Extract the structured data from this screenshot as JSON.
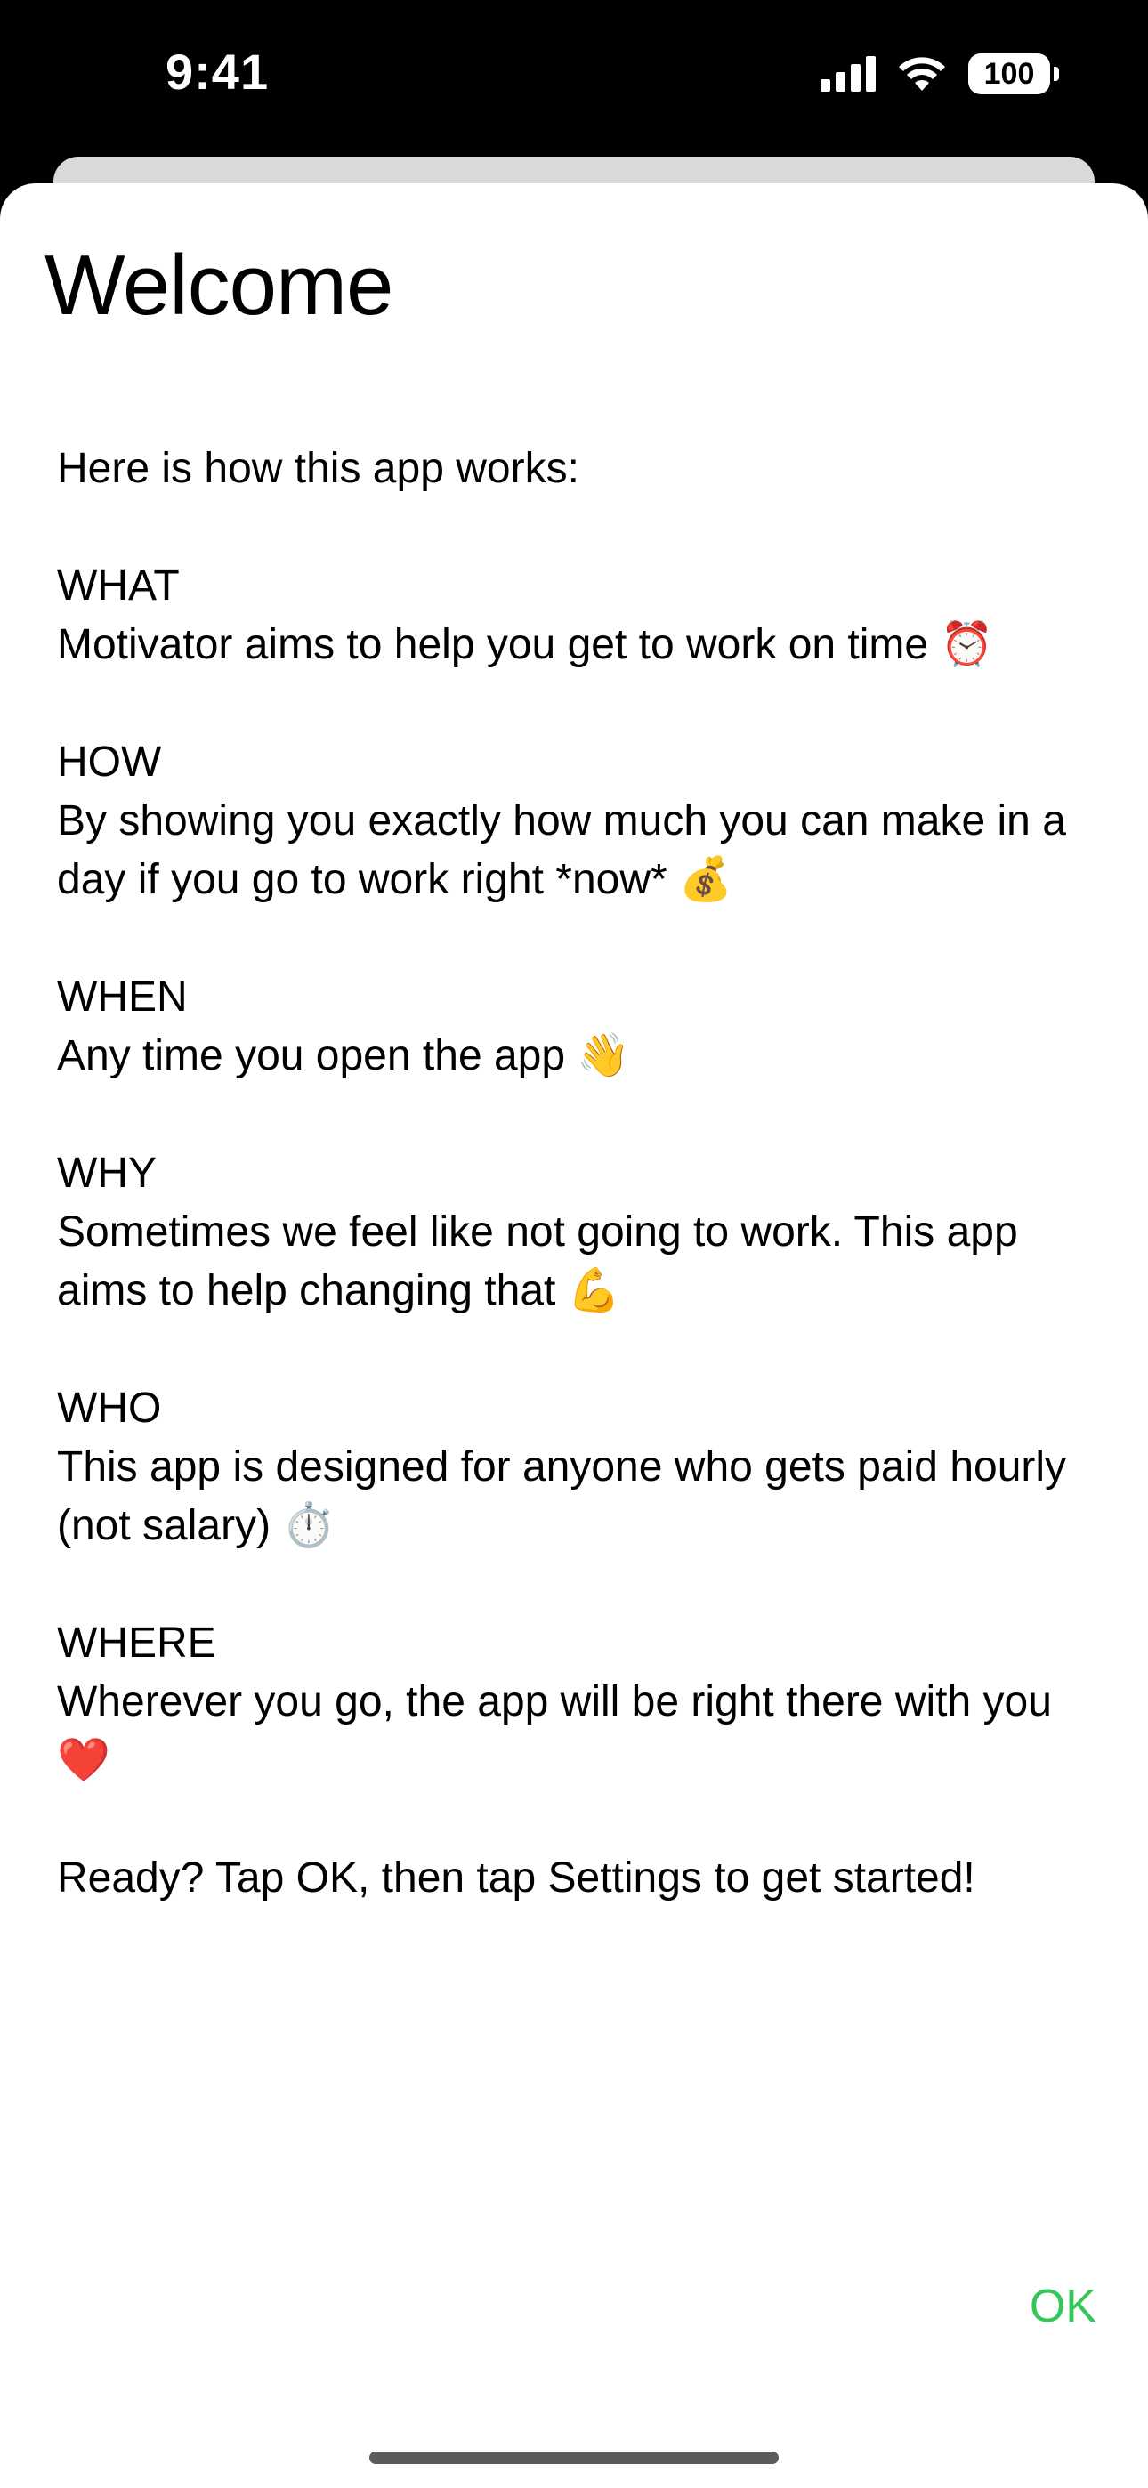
{
  "status_bar": {
    "time": "9:41",
    "battery": "100",
    "icons": [
      "cellular-signal-icon",
      "wifi-icon",
      "battery-icon"
    ]
  },
  "sheet": {
    "title": "Welcome",
    "intro": "Here is how this app works:",
    "sections": [
      {
        "heading": "WHAT",
        "body": "Motivator aims to help you get to work on time ⏰"
      },
      {
        "heading": "HOW",
        "body": "By showing you exactly how much you can make in a day if you go to work right *now* 💰"
      },
      {
        "heading": "WHEN",
        "body": "Any time you open the app 👋"
      },
      {
        "heading": "WHY",
        "body": "Sometimes we feel like not going to work. This app aims to help changing that 💪"
      },
      {
        "heading": "WHO",
        "body": "This app is designed for anyone who gets paid hourly (not salary) ⏱️"
      },
      {
        "heading": "WHERE",
        "body": "Wherever you go, the app will be right there with you ❤️"
      }
    ],
    "closing": "Ready? Tap OK, then tap Settings to get started!",
    "ok_label": "OK"
  },
  "colors": {
    "accent": "#34c759",
    "background": "#ffffff",
    "status_bar_bg": "#000000"
  }
}
